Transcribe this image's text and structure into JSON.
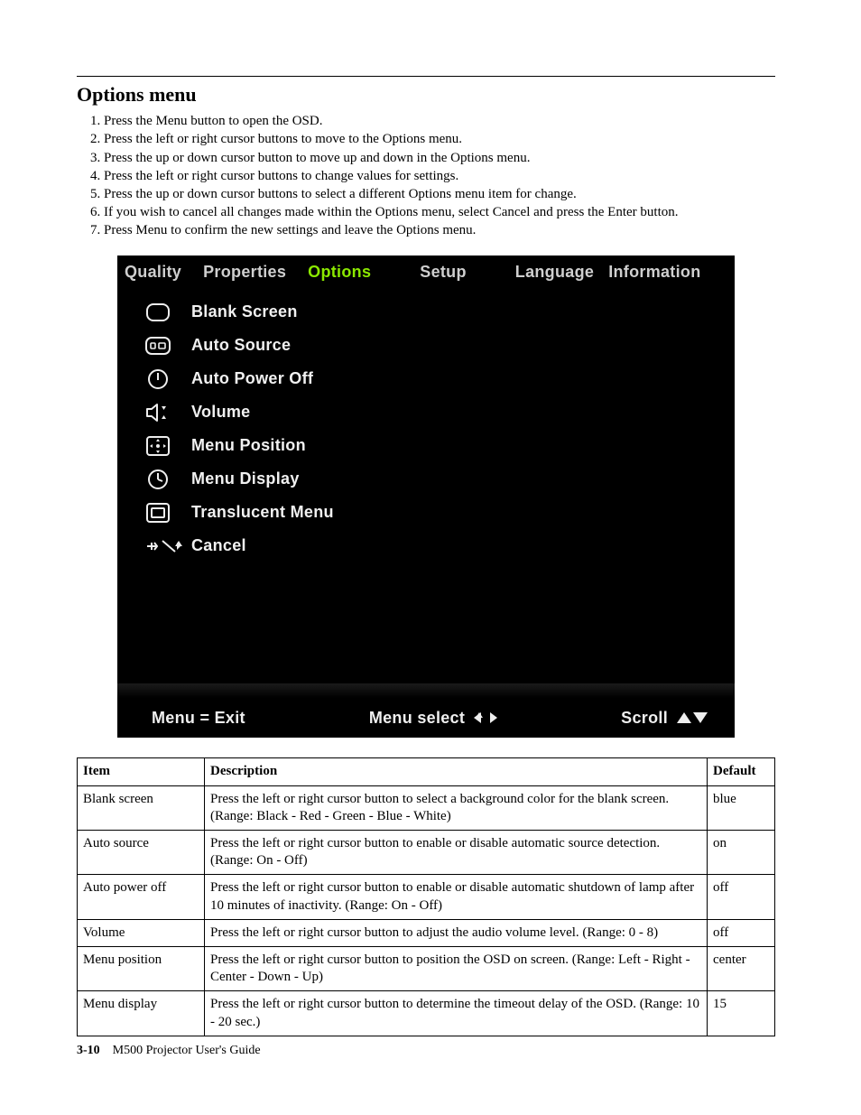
{
  "heading": "Options menu",
  "steps": [
    "Press the Menu button to open the OSD.",
    "Press the left or right cursor buttons to move to the Options menu.",
    "Press the up or down cursor button to move up and down in the Options menu.",
    "Press the left or right cursor buttons to change values for settings.",
    "Press the up or down cursor buttons to select a different Options menu item for change.",
    "If you wish to cancel all changes made within the Options menu, select Cancel and press the Enter button.",
    "Press Menu to confirm the new settings and leave the Options menu."
  ],
  "osd": {
    "tabs": [
      "Quality",
      "Properties",
      "Options",
      "Setup",
      "Language",
      "Information"
    ],
    "active_tab_index": 2,
    "items": [
      "Blank Screen",
      "Auto Source",
      "Auto Power Off",
      "Volume",
      "Menu Position",
      "Menu Display",
      "Translucent Menu",
      "Cancel"
    ],
    "footer": {
      "left": "Menu = Exit",
      "mid": "Menu select",
      "right": "Scroll"
    }
  },
  "table": {
    "headers": {
      "item": "Item",
      "description": "Description",
      "def": "Default"
    },
    "rows": [
      {
        "item": "Blank screen",
        "desc": "Press the left or right cursor button to select a background color for the blank screen. (Range: Black - Red - Green - Blue - White)",
        "def": "blue"
      },
      {
        "item": "Auto source",
        "desc": "Press the left or right cursor button to enable or disable automatic source detection. (Range: On - Off)",
        "def": "on"
      },
      {
        "item": "Auto power off",
        "desc": "Press the left or right cursor button to enable or disable automatic shutdown of lamp after 10 minutes of inactivity. (Range: On - Off)",
        "def": "off"
      },
      {
        "item": "Volume",
        "desc": "Press the left or right cursor button to adjust the audio volume level. (Range: 0 - 8)",
        "def": "off"
      },
      {
        "item": "Menu position",
        "desc": "Press the left or right cursor button to position the OSD on screen. (Range: Left - Right - Center - Down - Up)",
        "def": "center"
      },
      {
        "item": "Menu display",
        "desc": "Press the left or right cursor button to determine the timeout delay of the OSD. (Range: 10 - 20 sec.)",
        "def": "15"
      }
    ]
  },
  "footer": {
    "page_number": "3-10",
    "book": "M500 Projector User's Guide"
  }
}
